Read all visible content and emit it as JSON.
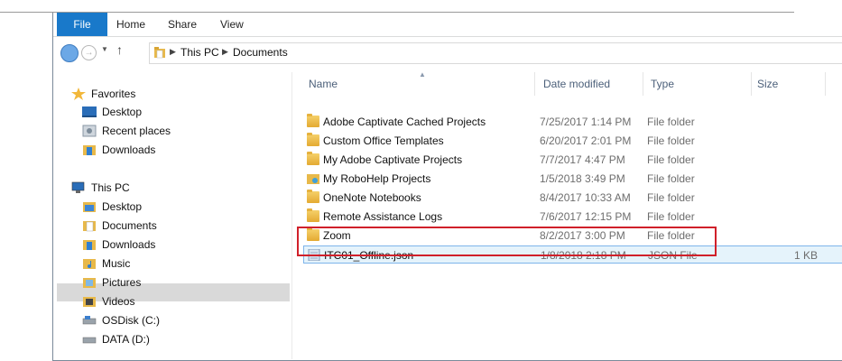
{
  "ribbon": {
    "tabs": [
      "File",
      "Home",
      "Share",
      "View"
    ]
  },
  "address": {
    "crumbs": [
      "This PC",
      "Documents"
    ]
  },
  "nav": {
    "favorites_label": "Favorites",
    "favorites": [
      "Desktop",
      "Recent places",
      "Downloads"
    ],
    "thispc_label": "This PC",
    "thispc": [
      "Desktop",
      "Documents",
      "Downloads",
      "Music",
      "Pictures",
      "Videos",
      "OSDisk (C:)",
      "DATA (D:)"
    ],
    "selected": "Documents"
  },
  "columns": {
    "name": "Name",
    "date": "Date modified",
    "type": "Type",
    "size": "Size"
  },
  "files": [
    {
      "name": "Adobe Captivate Cached Projects",
      "date": "7/25/2017 1:14 PM",
      "type": "File folder",
      "size": "",
      "icon": "folder-icon"
    },
    {
      "name": "Custom Office Templates",
      "date": "6/20/2017 2:01 PM",
      "type": "File folder",
      "size": "",
      "icon": "folder-icon"
    },
    {
      "name": "My Adobe Captivate Projects",
      "date": "7/7/2017 4:47 PM",
      "type": "File folder",
      "size": "",
      "icon": "folder-icon"
    },
    {
      "name": "My RoboHelp Projects",
      "date": "1/5/2018 3:49 PM",
      "type": "File folder",
      "size": "",
      "icon": "special-folder-icon"
    },
    {
      "name": "OneNote Notebooks",
      "date": "8/4/2017 10:33 AM",
      "type": "File folder",
      "size": "",
      "icon": "folder-icon"
    },
    {
      "name": "Remote Assistance Logs",
      "date": "7/6/2017 12:15 PM",
      "type": "File folder",
      "size": "",
      "icon": "folder-icon"
    },
    {
      "name": "Zoom",
      "date": "8/2/2017 3:00 PM",
      "type": "File folder",
      "size": "",
      "icon": "folder-icon"
    },
    {
      "name": "ITC01_Offline.json",
      "date": "1/8/2018 2:18 PM",
      "type": "JSON File",
      "size": "1 KB",
      "icon": "file-icon"
    }
  ],
  "colors": {
    "accent": "#1979ca",
    "highlight_border": "#d0202a",
    "selection": "#e5f3fb"
  }
}
